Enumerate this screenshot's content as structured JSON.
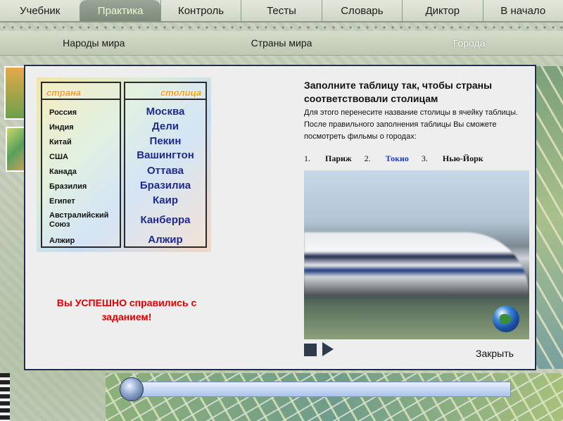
{
  "top_nav": [
    "Учебник",
    "Практика",
    "Контроль",
    "Тесты",
    "Словарь",
    "Диктор",
    "В начало"
  ],
  "top_nav_active": "Практика",
  "sub_nav": [
    "Народы мира",
    "Страны мира",
    "Города"
  ],
  "sub_nav_active": "Города",
  "table": {
    "country_header": "страна",
    "capital_header": "столица",
    "countries": [
      "Россия",
      "Индия",
      "Китай",
      "США",
      "Канада",
      "Бразилия",
      "Египет",
      "Австралийский Союз",
      "Алжир"
    ],
    "capitals": [
      "Москва",
      "Дели",
      "Пекин",
      "Вашингтон",
      "Оттава",
      "Бразилиа",
      "Каир",
      "Канберра",
      "Алжир"
    ]
  },
  "success_message": "Вы УСПЕШНО справились с заданием!",
  "instructions": {
    "title": "Заполните таблицу так, чтобы страны соответствовали столицам",
    "line1": "Для этого перенесите название столицы в ячейку таблицы.",
    "line2": "После правильного заполнения таблицы Вы сможете посмотреть фильмы о городах:"
  },
  "films": [
    {
      "num": "1.",
      "name": "Париж"
    },
    {
      "num": "2.",
      "name": "Токио"
    },
    {
      "num": "3.",
      "name": "Нью-Йорк"
    }
  ],
  "close_label": "Закрыть",
  "colors": {
    "success": "#e00000",
    "capital_text": "#1f2b8c",
    "dialog_border": "#1f2d52",
    "active_film": "#1a3cc0"
  },
  "icons": [
    "stop-icon",
    "play-icon",
    "globe-icon"
  ]
}
